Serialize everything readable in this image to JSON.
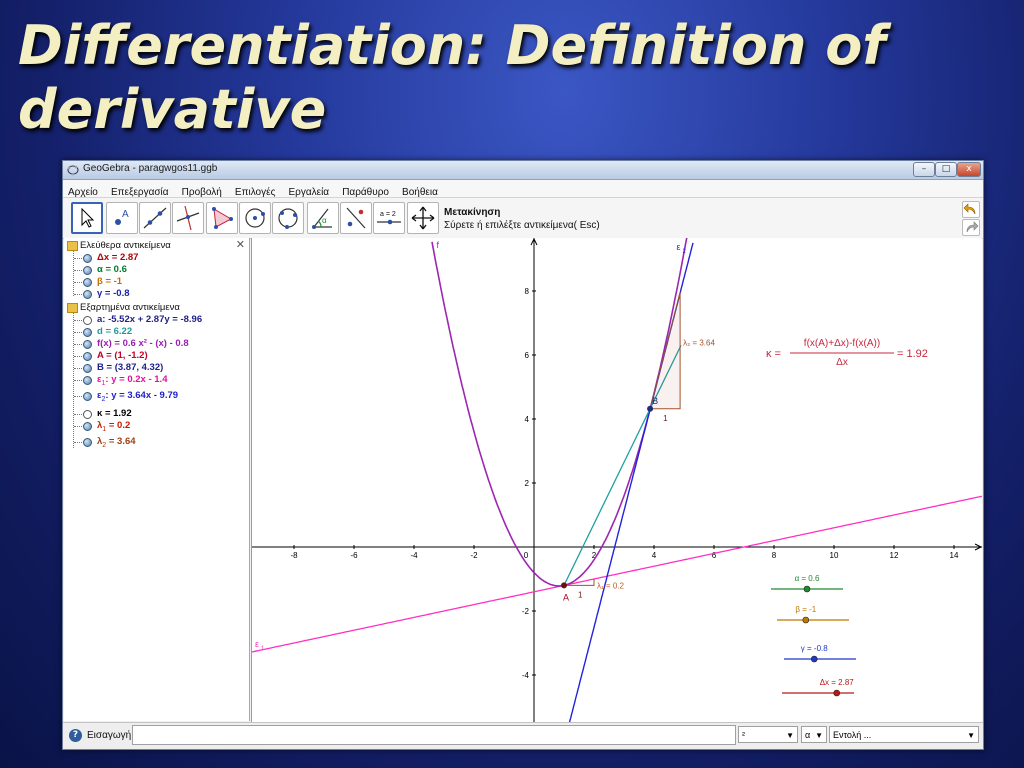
{
  "slide": {
    "title": "Differentiation:  Definition of derivative"
  },
  "window": {
    "title": "GeoGebra - paragwgos11.ggb",
    "controls": {
      "minimize": "–",
      "maximize": "□",
      "close": "x"
    }
  },
  "menu": [
    "Αρχείο",
    "Επεξεργασία",
    "Προβολή",
    "Επιλογές",
    "Εργαλεία",
    "Παράθυρο",
    "Βοήθεια"
  ],
  "toolbar": {
    "tools": [
      {
        "name": "move-tool-icon",
        "active": true
      },
      {
        "name": "point-tool-icon",
        "label": "A"
      },
      {
        "name": "line-tool-icon"
      },
      {
        "name": "perpendicular-line-tool-icon"
      },
      {
        "name": "polygon-tool-icon"
      },
      {
        "name": "circle-center-point-tool-icon"
      },
      {
        "name": "circle-three-points-tool-icon"
      },
      {
        "name": "angle-tool-icon",
        "label": "α"
      },
      {
        "name": "reflect-tool-icon"
      },
      {
        "name": "slider-tool-icon",
        "label": "a = 2"
      },
      {
        "name": "move-graphics-view-tool-icon"
      }
    ],
    "active_tool_name": "Μετακίνηση",
    "active_tool_help": "Σύρετε ή επιλέξτε αντικείμενα( Esc)"
  },
  "algebra": {
    "free_header": "Ελεύθερα αντικείμενα",
    "free": [
      {
        "name": "Δx",
        "value": " = 2.87",
        "color": "#b40000",
        "hollow": false
      },
      {
        "name": "α",
        "value": " = 0.6",
        "color": "#007c2a",
        "hollow": false
      },
      {
        "name": "β",
        "value": " = -1",
        "color": "#c07000",
        "hollow": false
      },
      {
        "name": "γ",
        "value": " = -0.8",
        "color": "#1b23a8",
        "hollow": false
      }
    ],
    "dependent_header": "Εξαρτημένα αντικείμενα",
    "dependent": [
      {
        "name": "a",
        "value": ": -5.52x + 2.87y = -8.96",
        "color": "#222288",
        "hollow": true
      },
      {
        "name": "d",
        "value": " = 6.22",
        "color": "#1f9a9a",
        "hollow": false
      },
      {
        "name": "f(x)",
        "value": " = 0.6 x² - (x) - 0.8",
        "color": "#9a1fb0",
        "hollow": false
      },
      {
        "name": "A",
        "value": " = (1, -1.2)",
        "color": "#c0002a",
        "hollow": false
      },
      {
        "name": "B",
        "value": " = (3.87, 4.32)",
        "color": "#20208a",
        "hollow": false
      },
      {
        "name": "ε",
        "sub": "1",
        "value": ": y = 0.2x - 1.4",
        "color": "#e0139e",
        "hollow": false
      },
      {
        "name": "ε",
        "sub": "2",
        "value": ": y = 3.64x - 9.79",
        "color": "#1f1fc8",
        "hollow": false
      },
      {
        "name": "κ",
        "value": " = 1.92",
        "color": "#000000",
        "hollow": true
      },
      {
        "name": "λ",
        "sub": "1",
        "value": " = 0.2",
        "color": "#c02000",
        "hollow": false
      },
      {
        "name": "λ",
        "sub": "2",
        "value": " = 3.64",
        "color": "#a04010",
        "hollow": false
      }
    ]
  },
  "graph": {
    "x_ticks": [
      "-8",
      "-6",
      "-4",
      "-2",
      "0",
      "2",
      "4",
      "6",
      "8",
      "10",
      "12",
      "14"
    ],
    "y_ticks": [
      "8",
      "6",
      "4",
      "2",
      "-2",
      "-4"
    ],
    "curve_label": "f",
    "tangent1_label": "ε",
    "tangent1_sub": "1",
    "tangent2_label": "ε",
    "tangent2_sub": "2",
    "point_A": "A",
    "point_B": "B",
    "lambda1_text": "λ₁ = 0.2",
    "lambda1_run": "1",
    "lambda2_text": "λ₂ = 3.64",
    "lambda2_run": "1",
    "formula": {
      "lhs": "κ =",
      "numerator": "f(x(A)+Δx)-f(x(A))",
      "denominator": "Δx",
      "result": "= 1.92"
    },
    "sliders": [
      {
        "label": "α = 0.6",
        "color": "#1f8a32",
        "fraction": 0.5
      },
      {
        "label": "β = -1",
        "color": "#c07800",
        "fraction": 0.4
      },
      {
        "label": "γ = -0.8",
        "color": "#2236c4",
        "fraction": 0.42
      },
      {
        "label": "Δx = 2.87",
        "color": "#b81a1a",
        "fraction": 0.76
      }
    ],
    "colors": {
      "curve": "#9c27b0",
      "tangent1": "#ff2fc4",
      "tangent2": "#2323d8",
      "secant": "#1fa0a0",
      "triangle": "#a0522d",
      "formula": "#c8273f"
    }
  },
  "inputbar": {
    "help": "?",
    "label": "Εισαγωγή:",
    "value": "",
    "combo1": "²",
    "combo2": "α",
    "combo3": "Εντολή ..."
  }
}
